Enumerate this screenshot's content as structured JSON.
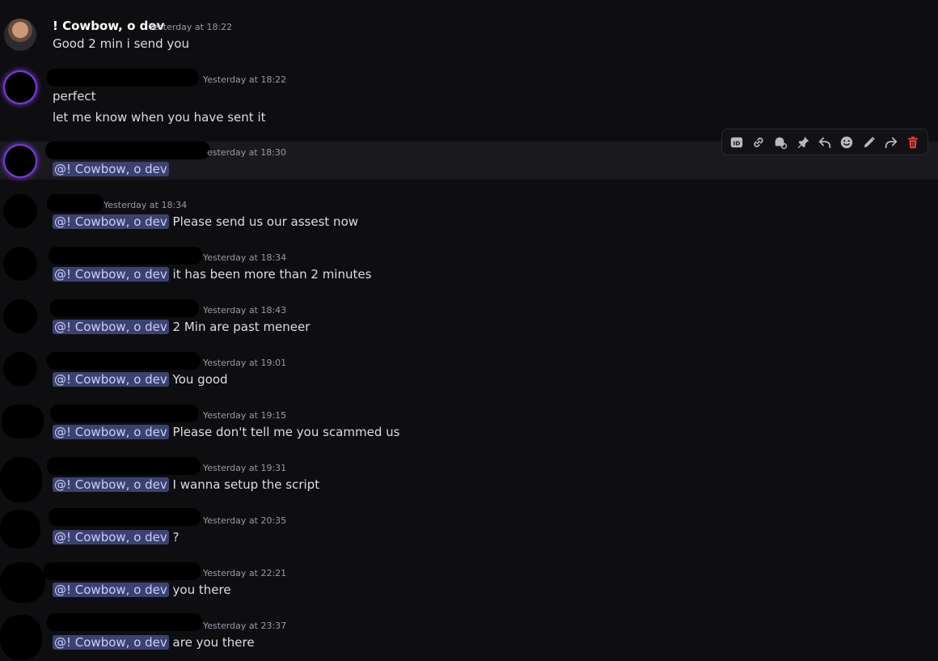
{
  "messages": [
    {
      "author": "! Cowbow, o dev",
      "timestamp": "Yesterday at 18:22",
      "lines": [
        "Good 2 min i send you"
      ]
    },
    {
      "author": "",
      "timestamp": "Yesterday at 18:22",
      "lines": [
        "perfect",
        "let me know when you have sent it"
      ]
    },
    {
      "author": "",
      "timestamp": "esterday at 18:30",
      "mention": "@! Cowbow, o dev",
      "text": ""
    },
    {
      "author": "",
      "timestamp": "Yesterday at 18:34",
      "mention": "@! Cowbow, o dev",
      "text": " Please send us our assest now"
    },
    {
      "author": "",
      "timestamp": "Yesterday at 18:34",
      "mention": "@! Cowbow, o dev",
      "text": " it has been more than 2 minutes"
    },
    {
      "author": "",
      "timestamp": "Yesterday at 18:43",
      "mention": "@! Cowbow, o dev",
      "text": " 2 Min are past meneer"
    },
    {
      "author": "",
      "timestamp": "Yesterday at 19:01",
      "mention": "@! Cowbow, o dev",
      "text": " You good"
    },
    {
      "author": "",
      "timestamp": "Yesterday at 19:15",
      "mention": "@! Cowbow, o dev",
      "text": " Please don't tell me you scammed us"
    },
    {
      "author": "",
      "timestamp": "Yesterday at 19:31",
      "mention": "@! Cowbow, o dev",
      "text": " I wanna setup the script"
    },
    {
      "author": "",
      "timestamp": "Yesterday at 20:35",
      "mention": "@! Cowbow, o dev",
      "text": " ?"
    },
    {
      "author": "",
      "timestamp": "Yesterday at 22:21",
      "mention": "@! Cowbow, o dev",
      "text": " you there"
    },
    {
      "author": "",
      "timestamp": "Yesterday at 23:37",
      "mention": "@! Cowbow, o dev",
      "text": " are you there"
    }
  ],
  "toolbar": {
    "icons": [
      "id-icon",
      "link-icon",
      "thread-icon",
      "pin-icon",
      "reply-icon",
      "emoji-icon",
      "edit-icon",
      "forward-icon",
      "delete-icon"
    ],
    "delete_color": "#f23f43"
  }
}
